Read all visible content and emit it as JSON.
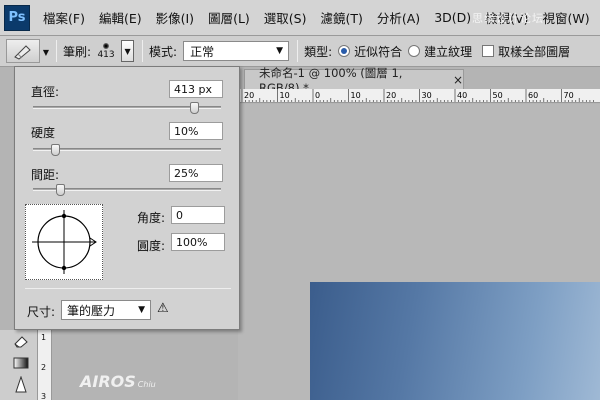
{
  "app": {
    "logo": "Ps"
  },
  "menu": [
    "檔案(F)",
    "編輯(E)",
    "影像(I)",
    "圖層(L)",
    "選取(S)",
    "濾鏡(T)",
    "分析(A)",
    "3D(D)",
    "檢視(V)",
    "視窗(W)"
  ],
  "watermark": "思缘设计论坛",
  "options": {
    "brush_label": "筆刷:",
    "brush_size": "413",
    "mode_label": "模式:",
    "mode_value": "正常",
    "type_label": "類型:",
    "radio1": "近似符合",
    "radio2": "建立紋理",
    "checkbox": "取樣全部圖層"
  },
  "document": {
    "tab_title": "未命名-1 @ 100% (圖層 1, RGB/8) *",
    "close": "×"
  },
  "ruler_h": [
    "20",
    "10",
    "0",
    "10",
    "20",
    "30",
    "40",
    "50",
    "60",
    "70"
  ],
  "ruler_v": [
    "1",
    "2",
    "3"
  ],
  "panel": {
    "diameter_label": "直徑:",
    "diameter_value": "413 px",
    "hardness_label": "硬度",
    "hardness_value": "10%",
    "spacing_label": "間距:",
    "spacing_value": "25%",
    "angle_label": "角度:",
    "angle_value": "0",
    "roundness_label": "圓度:",
    "roundness_value": "100%",
    "size_label": "尺寸:",
    "size_value": "筆的壓力",
    "diameter_level": 0.88,
    "hardness_level": 0.1,
    "spacing_level": 0.13
  },
  "brand": {
    "name": "AIROS",
    "sub": "Chiu"
  }
}
